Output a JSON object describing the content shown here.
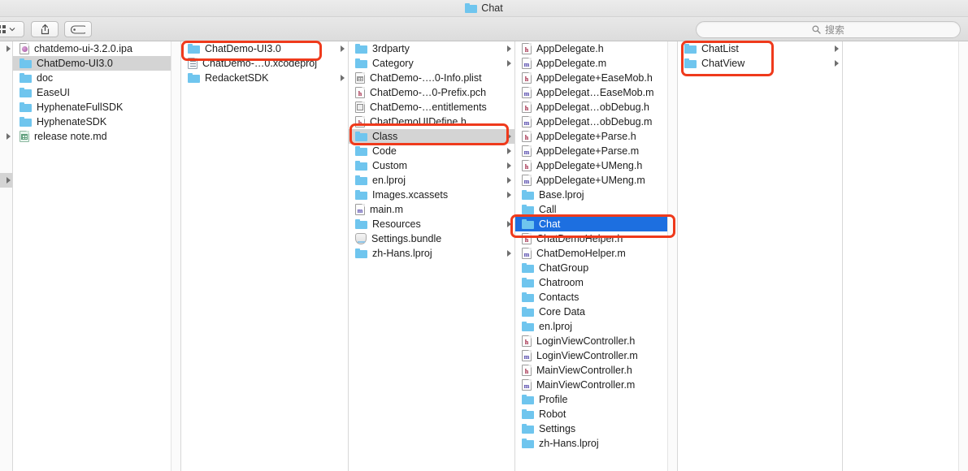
{
  "window": {
    "title": "Chat",
    "title_icon": "folder-icon"
  },
  "toolbar": {
    "arrange_button_label": "arrange-icon",
    "share_button_label": "share-icon",
    "tag_button_label": "tag-icon",
    "search": {
      "icon": "search-icon",
      "placeholder": "搜索",
      "value": ""
    }
  },
  "columns": [
    {
      "name": "column-partial-left",
      "partial": true,
      "rows": [
        {
          "disclosure": true,
          "selected": false
        },
        {
          "disclosure": false,
          "selected": false
        },
        {
          "disclosure": false,
          "selected": false
        },
        {
          "disclosure": false,
          "selected": false
        },
        {
          "disclosure": false,
          "selected": false
        },
        {
          "disclosure": false,
          "selected": false
        },
        {
          "disclosure": true,
          "selected": false
        },
        {
          "disclosure": false,
          "selected": false
        },
        {
          "disclosure": false,
          "selected": false
        },
        {
          "disclosure": true,
          "selected": true
        }
      ]
    },
    {
      "name": "column-root",
      "rows": [
        {
          "label": "chatdemo-ui-3.2.0.ipa",
          "icon": "ipa-file-icon",
          "disclosure": false,
          "selected": false
        },
        {
          "label": "ChatDemo-UI3.0",
          "icon": "folder-icon",
          "disclosure": true,
          "selected": true
        },
        {
          "label": "doc",
          "icon": "folder-icon",
          "disclosure": true,
          "selected": false
        },
        {
          "label": "EaseUI",
          "icon": "folder-icon",
          "disclosure": true,
          "selected": false
        },
        {
          "label": "HyphenateFullSDK",
          "icon": "folder-icon",
          "disclosure": true,
          "selected": false
        },
        {
          "label": "HyphenateSDK",
          "icon": "folder-icon",
          "disclosure": true,
          "selected": false
        },
        {
          "label": "release note.md",
          "icon": "markdown-file-icon",
          "disclosure": false,
          "selected": false
        }
      ]
    },
    {
      "name": "column-chatdemo-ui3",
      "rows": [
        {
          "label": "ChatDemo-UI3.0",
          "icon": "folder-icon",
          "disclosure": true,
          "selected": false
        },
        {
          "label": "ChatDemo-…0.xcodeproj",
          "icon": "xcodeproj-file-icon",
          "disclosure": false,
          "selected": false
        },
        {
          "label": "RedacketSDK",
          "icon": "folder-icon",
          "disclosure": true,
          "selected": false
        }
      ]
    },
    {
      "name": "column-project",
      "rows": [
        {
          "label": "3rdparty",
          "icon": "folder-icon",
          "disclosure": true,
          "selected": false
        },
        {
          "label": "Category",
          "icon": "folder-icon",
          "disclosure": true,
          "selected": false
        },
        {
          "label": "ChatDemo-….0-Info.plist",
          "icon": "plist-file-icon",
          "disclosure": false,
          "selected": false
        },
        {
          "label": "ChatDemo-…0-Prefix.pch",
          "icon": "h-file-icon",
          "disclosure": false,
          "selected": false
        },
        {
          "label": "ChatDemo-…entitlements",
          "icon": "entitlements-file-icon",
          "disclosure": false,
          "selected": false
        },
        {
          "label": "ChatDemoUIDefine.h",
          "icon": "h-file-icon",
          "disclosure": false,
          "selected": false
        },
        {
          "label": "Class",
          "icon": "folder-icon",
          "disclosure": true,
          "selected": true
        },
        {
          "label": "Code",
          "icon": "folder-icon",
          "disclosure": true,
          "selected": false
        },
        {
          "label": "Custom",
          "icon": "folder-icon",
          "disclosure": true,
          "selected": false
        },
        {
          "label": "en.lproj",
          "icon": "folder-icon",
          "disclosure": true,
          "selected": false
        },
        {
          "label": "Images.xcassets",
          "icon": "folder-icon",
          "disclosure": true,
          "selected": false
        },
        {
          "label": "main.m",
          "icon": "m-file-icon",
          "disclosure": false,
          "selected": false
        },
        {
          "label": "Resources",
          "icon": "folder-icon",
          "disclosure": true,
          "selected": false
        },
        {
          "label": "Settings.bundle",
          "icon": "bundle-icon",
          "disclosure": false,
          "selected": false
        },
        {
          "label": "zh-Hans.lproj",
          "icon": "folder-icon",
          "disclosure": true,
          "selected": false
        }
      ]
    },
    {
      "name": "column-class",
      "rows": [
        {
          "label": "AppDelegate.h",
          "icon": "h-file-icon",
          "disclosure": false,
          "selected": false
        },
        {
          "label": "AppDelegate.m",
          "icon": "m-file-icon",
          "disclosure": false,
          "selected": false
        },
        {
          "label": "AppDelegate+EaseMob.h",
          "icon": "h-file-icon",
          "disclosure": false,
          "selected": false
        },
        {
          "label": "AppDelegat…EaseMob.m",
          "icon": "m-file-icon",
          "disclosure": false,
          "selected": false
        },
        {
          "label": "AppDelegat…obDebug.h",
          "icon": "h-file-icon",
          "disclosure": false,
          "selected": false
        },
        {
          "label": "AppDelegat…obDebug.m",
          "icon": "m-file-icon",
          "disclosure": false,
          "selected": false
        },
        {
          "label": "AppDelegate+Parse.h",
          "icon": "h-file-icon",
          "disclosure": false,
          "selected": false
        },
        {
          "label": "AppDelegate+Parse.m",
          "icon": "m-file-icon",
          "disclosure": false,
          "selected": false
        },
        {
          "label": "AppDelegate+UMeng.h",
          "icon": "h-file-icon",
          "disclosure": false,
          "selected": false
        },
        {
          "label": "AppDelegate+UMeng.m",
          "icon": "m-file-icon",
          "disclosure": false,
          "selected": false
        },
        {
          "label": "Base.lproj",
          "icon": "folder-icon",
          "disclosure": true,
          "selected": false
        },
        {
          "label": "Call",
          "icon": "folder-icon",
          "disclosure": true,
          "selected": false
        },
        {
          "label": "Chat",
          "icon": "folder-icon",
          "disclosure": true,
          "selected": true
        },
        {
          "label": "ChatDemoHelper.h",
          "icon": "h-file-icon",
          "disclosure": false,
          "selected": false
        },
        {
          "label": "ChatDemoHelper.m",
          "icon": "m-file-icon",
          "disclosure": false,
          "selected": false
        },
        {
          "label": "ChatGroup",
          "icon": "folder-icon",
          "disclosure": true,
          "selected": false
        },
        {
          "label": "Chatroom",
          "icon": "folder-icon",
          "disclosure": true,
          "selected": false
        },
        {
          "label": "Contacts",
          "icon": "folder-icon",
          "disclosure": true,
          "selected": false
        },
        {
          "label": "Core Data",
          "icon": "folder-icon",
          "disclosure": true,
          "selected": false
        },
        {
          "label": "en.lproj",
          "icon": "folder-icon",
          "disclosure": true,
          "selected": false
        },
        {
          "label": "LoginViewController.h",
          "icon": "h-file-icon",
          "disclosure": false,
          "selected": false
        },
        {
          "label": "LoginViewController.m",
          "icon": "m-file-icon",
          "disclosure": false,
          "selected": false
        },
        {
          "label": "MainViewController.h",
          "icon": "h-file-icon",
          "disclosure": false,
          "selected": false
        },
        {
          "label": "MainViewController.m",
          "icon": "m-file-icon",
          "disclosure": false,
          "selected": false
        },
        {
          "label": "Profile",
          "icon": "folder-icon",
          "disclosure": true,
          "selected": false
        },
        {
          "label": "Robot",
          "icon": "folder-icon",
          "disclosure": true,
          "selected": false
        },
        {
          "label": "Settings",
          "icon": "folder-icon",
          "disclosure": true,
          "selected": false
        },
        {
          "label": "zh-Hans.lproj",
          "icon": "folder-icon",
          "disclosure": true,
          "selected": false
        }
      ]
    },
    {
      "name": "column-chat",
      "rows": [
        {
          "label": "ChatList",
          "icon": "folder-icon",
          "disclosure": true,
          "selected": false
        },
        {
          "label": "ChatView",
          "icon": "folder-icon",
          "disclosure": true,
          "selected": false
        }
      ]
    },
    {
      "name": "column-empty",
      "rows": []
    }
  ],
  "annotations": {
    "color": "#EF3A1C",
    "boxes": [
      {
        "name": "highlight-chatdemo-ui3",
        "target": "ChatDemo-UI3.0"
      },
      {
        "name": "highlight-class",
        "target": "Class"
      },
      {
        "name": "highlight-chat",
        "target": "Chat"
      },
      {
        "name": "highlight-chatlist-chatview",
        "target": "ChatList / ChatView"
      }
    ]
  }
}
